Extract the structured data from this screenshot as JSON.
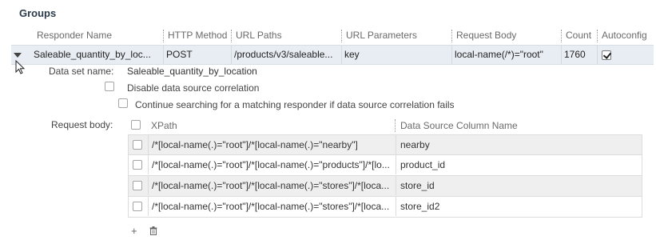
{
  "groups_title": "Groups",
  "responder_table": {
    "columns": [
      "Responder Name",
      "HTTP Method",
      "URL Paths",
      "URL Parameters",
      "Request Body",
      "Count",
      "Autoconfig"
    ],
    "row": {
      "responder_name": "Saleable_quantity_by_loc...",
      "http_method": "POST",
      "url_paths": "/products/v3/saleable...",
      "url_parameters": "key",
      "request_body": "local-name(/*)=\"root\"",
      "count": "1760",
      "autoconfig": true
    }
  },
  "details": {
    "data_set_label": "Data set name:",
    "data_set_value": "Saleable_quantity_by_location",
    "disable_correlation_label": "Disable data source correlation",
    "disable_correlation_checked": false,
    "continue_searching_label": "Continue searching for a matching responder if data source correlation fails",
    "continue_searching_checked": false,
    "request_body_label": "Request body:"
  },
  "request_body_table": {
    "columns": [
      "XPath",
      "Data Source Column Name"
    ],
    "rows": [
      {
        "xpath": "/*[local-name(.)=\"root\"]/*[local-name(.)=\"nearby\"]",
        "column": "nearby"
      },
      {
        "xpath": "/*[local-name(.)=\"root\"]/*[local-name(.)=\"products\"]/*[lo...",
        "column": "product_id"
      },
      {
        "xpath": "/*[local-name(.)=\"root\"]/*[local-name(.)=\"stores\"]/*[loca...",
        "column": "store_id"
      },
      {
        "xpath": "/*[local-name(.)=\"root\"]/*[local-name(.)=\"stores\"]/*[loca...",
        "column": "store_id2"
      }
    ]
  },
  "footer": {
    "add_icon": "+",
    "delete_icon": "trash-icon"
  }
}
